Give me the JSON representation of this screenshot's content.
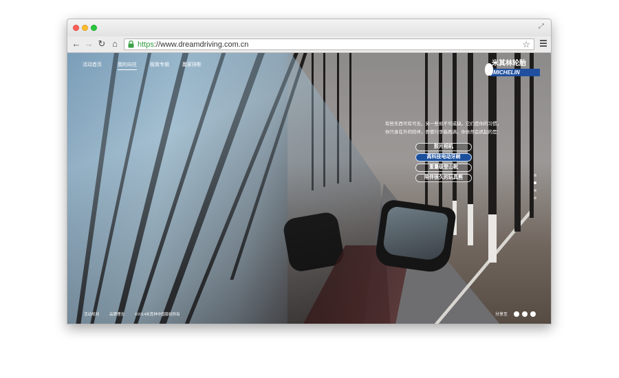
{
  "browser": {
    "url_scheme": "https",
    "url_rest": "://www.dreamdriving.com.cn"
  },
  "site": {
    "nav": [
      {
        "label": "活动首页"
      },
      {
        "label": "我的向往"
      },
      {
        "label": "极致专辑"
      },
      {
        "label": "赢家排影"
      }
    ],
    "active_nav_index": 1,
    "logo_cn": "米其林轮胎",
    "logo_en": "MICHELIN",
    "intro_lines": [
      "有些东西可有可无，另一些却不可或缺。它们是你的习惯，",
      "你只身在外的陪伴，即使行李箱再满，你依然会抓起的是："
    ],
    "options": [
      {
        "label": "胶片相机",
        "selected": false
      },
      {
        "label": "高科技电动牙刷",
        "selected": true
      },
      {
        "label": "重量级登山靴",
        "selected": false
      },
      {
        "label": "陪伴很久的玩具熊",
        "selected": false
      }
    ],
    "footer": {
      "rules": "活动规则",
      "brand": "品牌理念",
      "copyright": "©2014米其林中国版权所有",
      "share": "分享至"
    },
    "colors": {
      "michelin_blue": "#1f4f9e",
      "selected_option": "#1b4f9c"
    }
  }
}
